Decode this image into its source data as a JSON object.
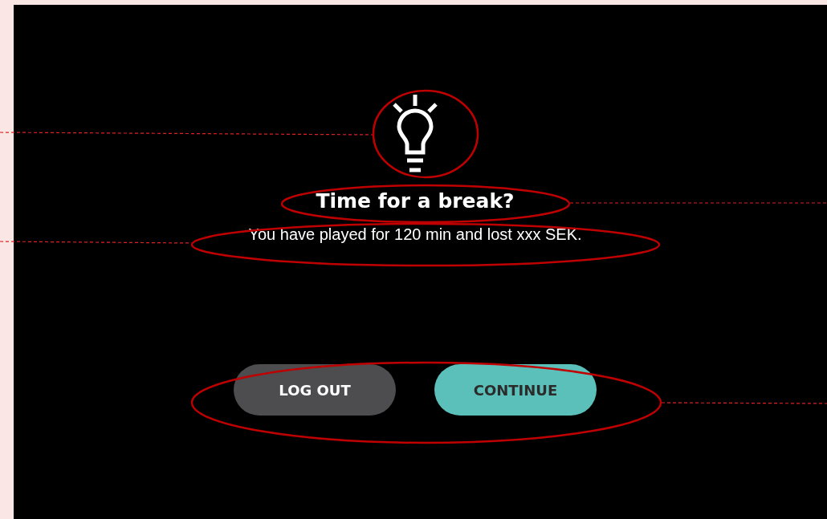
{
  "dialog": {
    "title": "Time for a break?",
    "message": "You  have played for 120 min and lost xxx SEK.",
    "buttons": [
      {
        "label": "LOG OUT",
        "kind": "secondary"
      },
      {
        "label": "CONTINUE",
        "kind": "primary"
      }
    ]
  }
}
